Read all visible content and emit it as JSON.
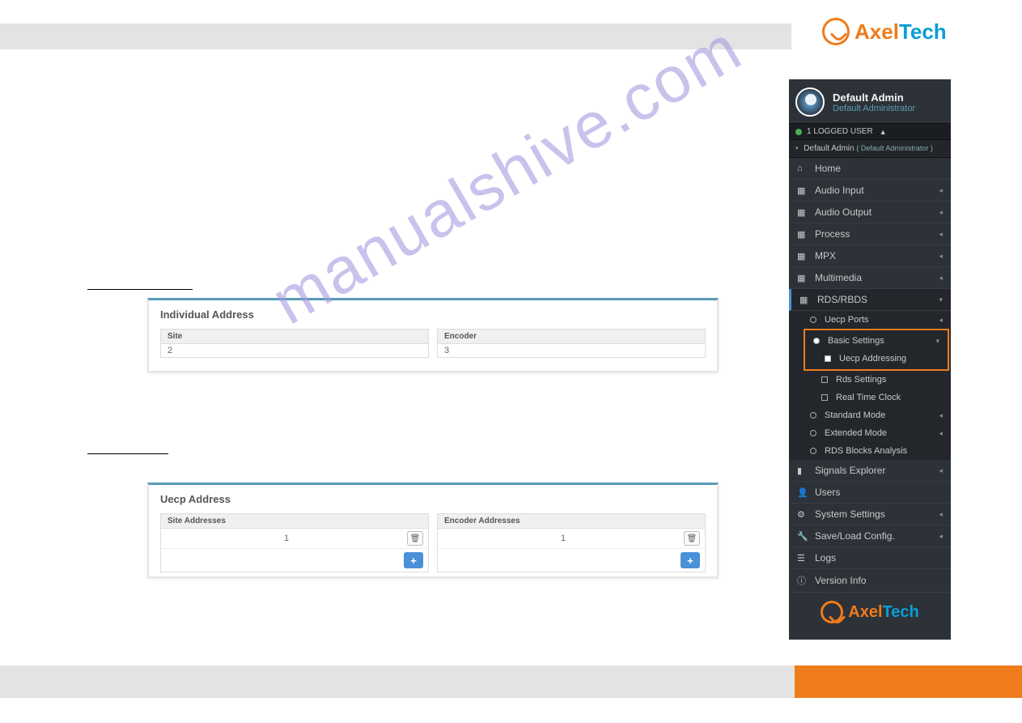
{
  "logo": {
    "part1": "Axel",
    "part2": "Tech"
  },
  "watermark": "manualshive.com",
  "panel1": {
    "title": "Individual Address",
    "siteLabel": "Site",
    "siteValue": "2",
    "encoderLabel": "Encoder",
    "encoderValue": "3"
  },
  "panel2": {
    "title": "Uecp Address",
    "siteHeader": "Site Addresses",
    "siteVal": "1",
    "encoderHeader": "Encoder Addresses",
    "encoderVal": "1"
  },
  "sidebar": {
    "userName": "Default Admin",
    "userRole": "Default Administrator",
    "loggedCount": "1 LOGGED USER",
    "loggedDetailName": "Default Admin",
    "loggedDetailRole": "Default Administrator",
    "nav": {
      "home": "Home",
      "audioInput": "Audio Input",
      "audioOutput": "Audio Output",
      "process": "Process",
      "mpx": "MPX",
      "multimedia": "Multimedia",
      "rds": "RDS/RBDS",
      "uecpPorts": "Uecp Ports",
      "basicSettings": "Basic Settings",
      "uecpAddressing": "Uecp Addressing",
      "rdsSettings": "Rds Settings",
      "realTimeClock": "Real Time Clock",
      "standardMode": "Standard Mode",
      "extendedMode": "Extended Mode",
      "rdsBlocks": "RDS Blocks Analysis",
      "signalsExplorer": "Signals Explorer",
      "users": "Users",
      "systemSettings": "System Settings",
      "saveLoad": "Save/Load Config.",
      "logs": "Logs",
      "versionInfo": "Version Info"
    }
  }
}
